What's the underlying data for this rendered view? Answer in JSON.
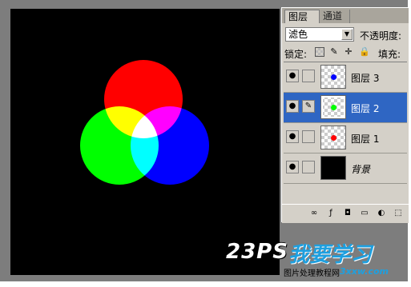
{
  "panel": {
    "tabs": [
      {
        "label": "图层",
        "active": true
      },
      {
        "label": "通道",
        "active": false
      }
    ],
    "blend_mode": "滤色",
    "opacity_label": "不透明度:",
    "lock_label": "锁定:",
    "fill_label": "填充:",
    "layers": [
      {
        "name": "图层 3",
        "dot_color": "#0000ff",
        "selected": false,
        "visible": true
      },
      {
        "name": "图层 2",
        "dot_color": "#00ff00",
        "selected": true,
        "visible": true
      },
      {
        "name": "图层 1",
        "dot_color": "#ff0000",
        "selected": false,
        "visible": true
      },
      {
        "name": "背景",
        "dot_color": null,
        "selected": false,
        "visible": true
      }
    ],
    "bottom_icons": [
      "link-layers-icon",
      "add-style-icon",
      "add-mask-icon",
      "new-group-icon",
      "adjustment-layer-icon",
      "new-layer-icon"
    ]
  },
  "canvas": {
    "background": "#000000",
    "circle_colors": {
      "red": "#ff0000",
      "green": "#00ff00",
      "blue": "#0000ff"
    }
  },
  "watermark": {
    "logo": "23PS",
    "logo_cn": "我要学习",
    "caption": "图片处理教程网",
    "url": "3xxw.com"
  }
}
